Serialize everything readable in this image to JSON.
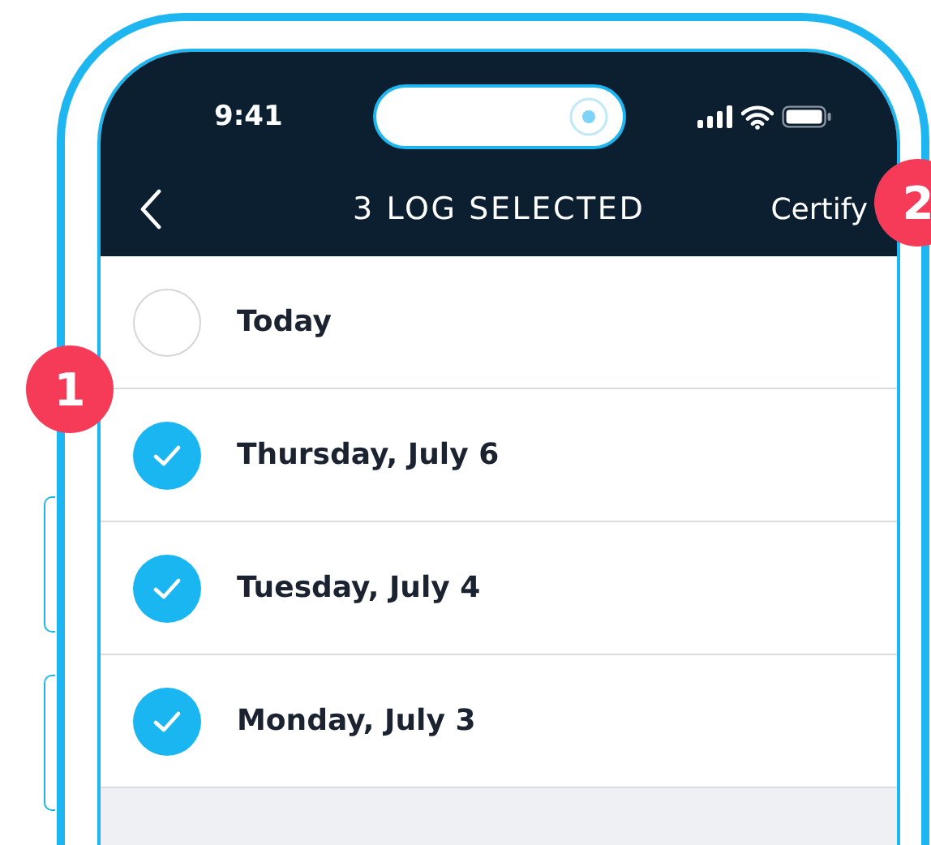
{
  "status_bar": {
    "time": "9:41"
  },
  "nav_bar": {
    "title": "3 LOG SELECTED",
    "action": "Certify"
  },
  "logs": [
    {
      "label": "Today",
      "selected": false
    },
    {
      "label": "Thursday, July 6",
      "selected": true
    },
    {
      "label": "Tuesday, July 4",
      "selected": true
    },
    {
      "label": "Monday, July 3",
      "selected": true
    }
  ],
  "callouts": [
    "1",
    "2"
  ]
}
